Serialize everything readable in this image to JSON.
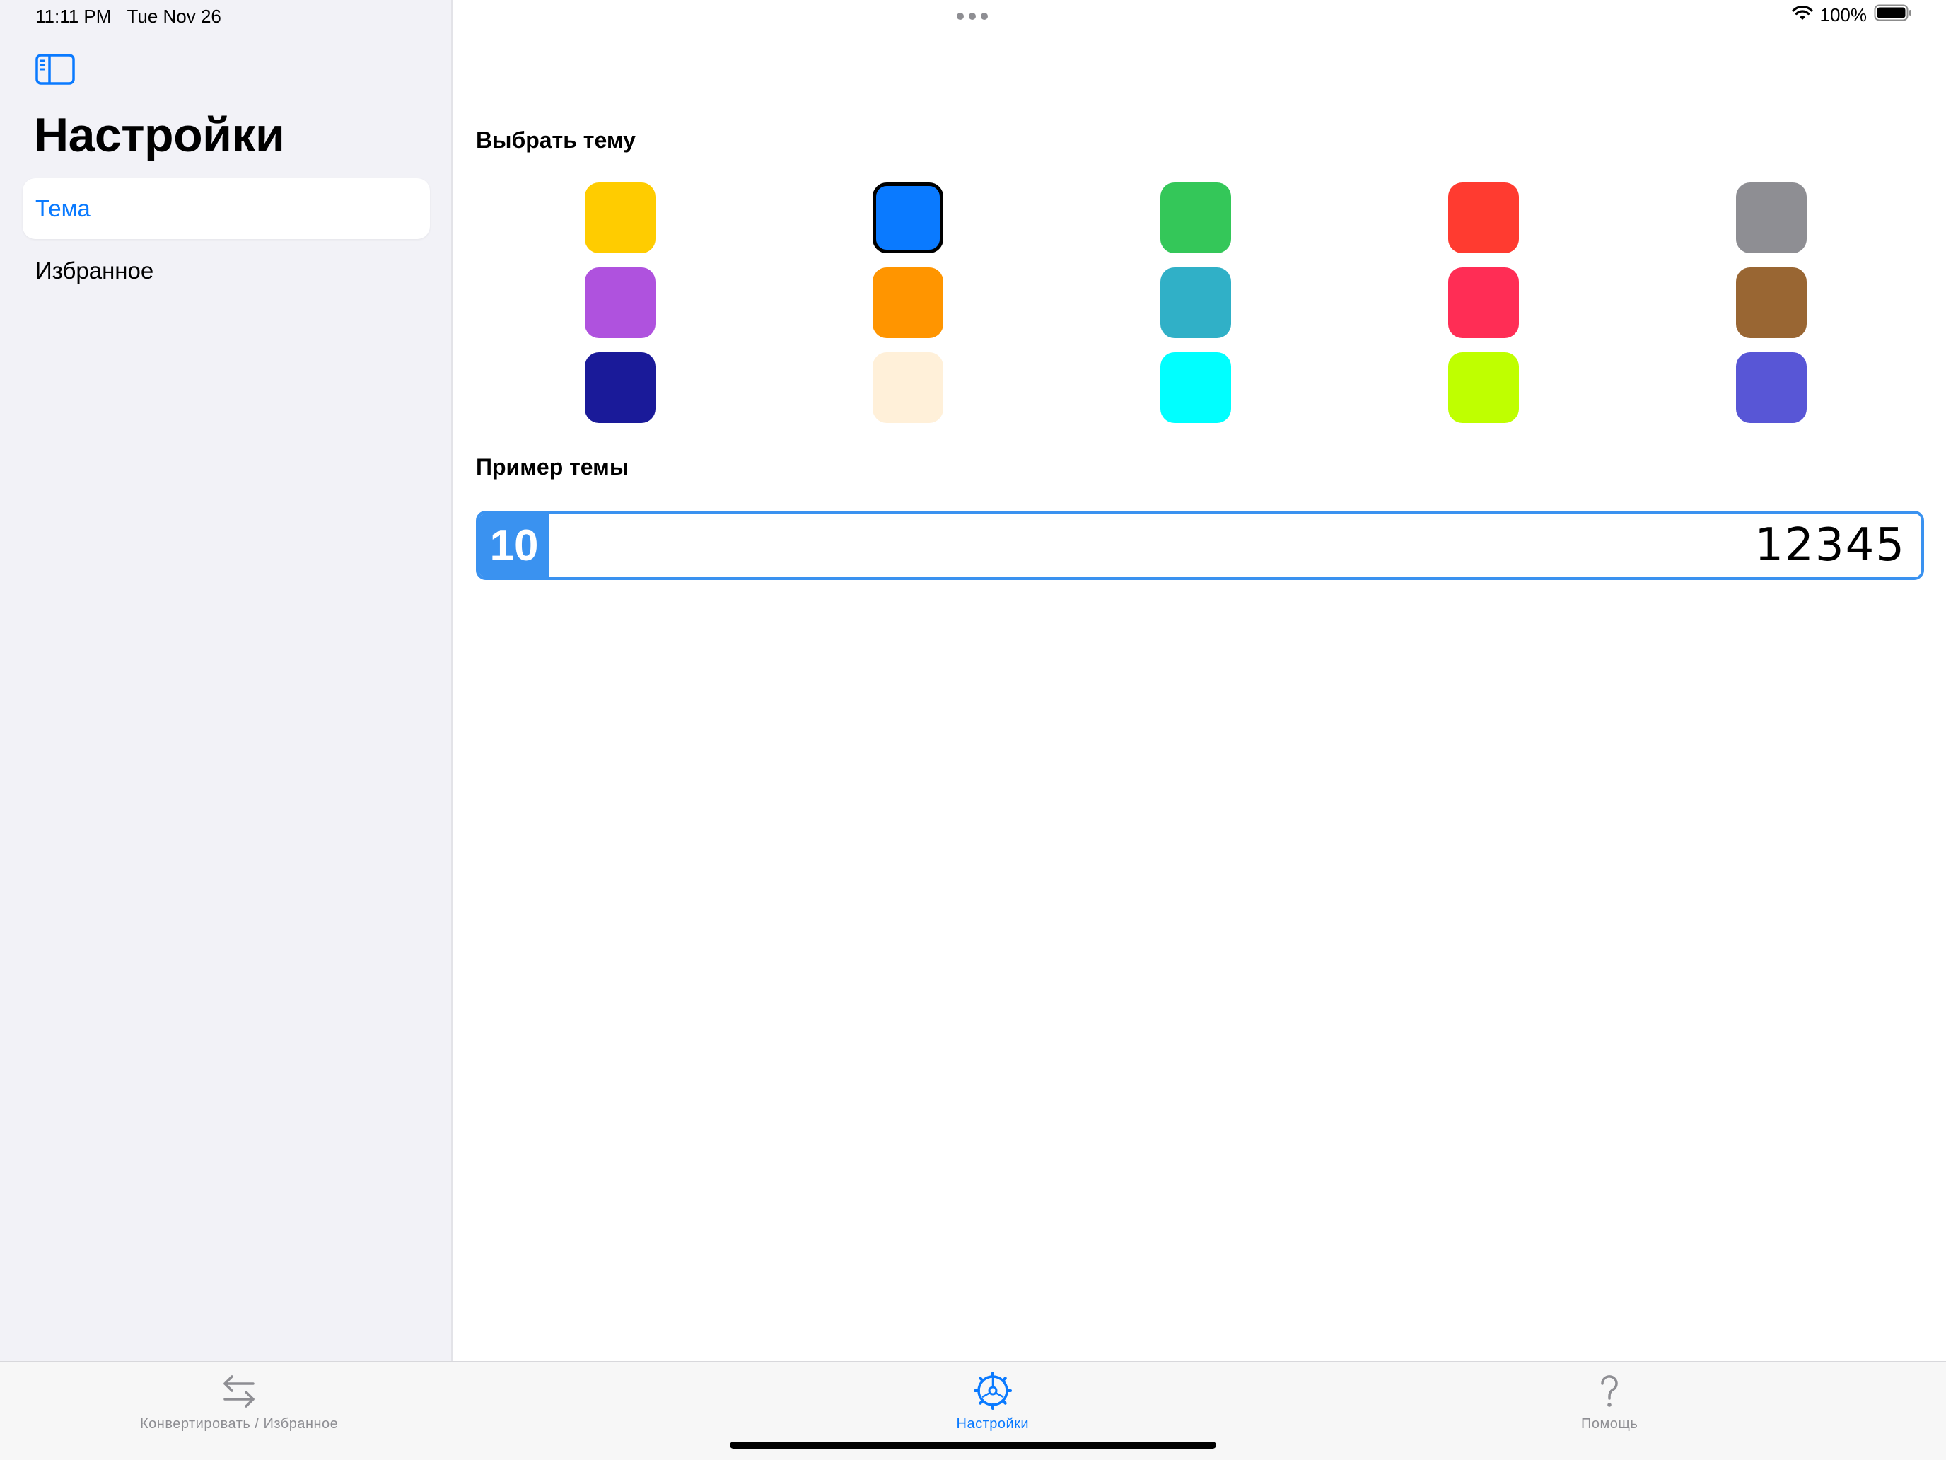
{
  "status_bar": {
    "time": "11:11 PM",
    "date": "Tue Nov 26",
    "battery": "100%"
  },
  "sidebar": {
    "title": "Настройки",
    "items": [
      {
        "label": "Тема",
        "selected": true
      },
      {
        "label": "Избранное",
        "selected": false
      }
    ]
  },
  "main": {
    "choose_theme_title": "Выбрать тему",
    "swatches": [
      {
        "color": "#ffcc00",
        "selected": false
      },
      {
        "color": "#0a7aff",
        "selected": true
      },
      {
        "color": "#34c759",
        "selected": false
      },
      {
        "color": "#ff3b30",
        "selected": false
      },
      {
        "color": "#8e8e93",
        "selected": false
      },
      {
        "color": "#af52de",
        "selected": false
      },
      {
        "color": "#ff9500",
        "selected": false
      },
      {
        "color": "#30b0c7",
        "selected": false
      },
      {
        "color": "#ff2d55",
        "selected": false
      },
      {
        "color": "#996633",
        "selected": false
      },
      {
        "color": "#1a1a99",
        "selected": false
      },
      {
        "color": "#fff0d9",
        "selected": false
      },
      {
        "color": "#00ffff",
        "selected": false
      },
      {
        "color": "#bfff00",
        "selected": false
      },
      {
        "color": "#5856d6",
        "selected": false
      }
    ],
    "example_title": "Пример темы",
    "example_base": "10",
    "example_value": "12345"
  },
  "tabbar": {
    "tabs": [
      {
        "label": "Конвертировать / Избранное",
        "icon": "arrows-swap-icon",
        "active": false
      },
      {
        "label": "Настройки",
        "icon": "gear-icon",
        "active": true
      },
      {
        "label": "Помощь",
        "icon": "question-mark-icon",
        "active": false
      }
    ]
  },
  "colors": {
    "accent": "#0a7aff",
    "example_accent": "#3a92f0"
  }
}
